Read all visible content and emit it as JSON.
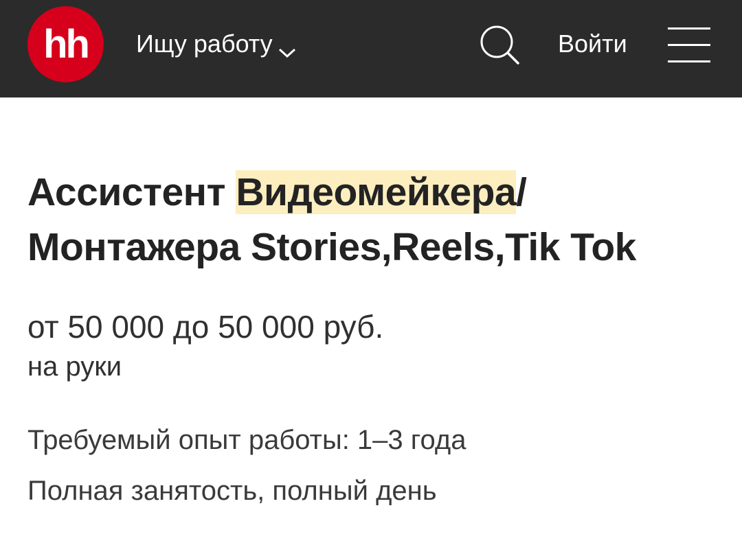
{
  "header": {
    "logo_text": "hh",
    "role_switch_label": "Ищу работу",
    "login_label": "Войти",
    "icons": {
      "chevron": "chevron-down-icon",
      "search": "search-icon",
      "menu": "hamburger-menu-icon"
    },
    "colors": {
      "background": "#2b2b2b",
      "logo": "#d6001c"
    }
  },
  "vacancy": {
    "title_prefix": "Ассистент ",
    "title_highlight": "Видеомейкера",
    "title_suffix": "/ Монтажера Stories,Reels,Tik Tok",
    "salary": "от 50 000 до 50 000 руб.",
    "salary_note": "на руки",
    "experience": "Требуемый опыт работы: 1–3 года",
    "employment": "Полная занятость, полный день",
    "highlight_color": "#fdeec0"
  }
}
